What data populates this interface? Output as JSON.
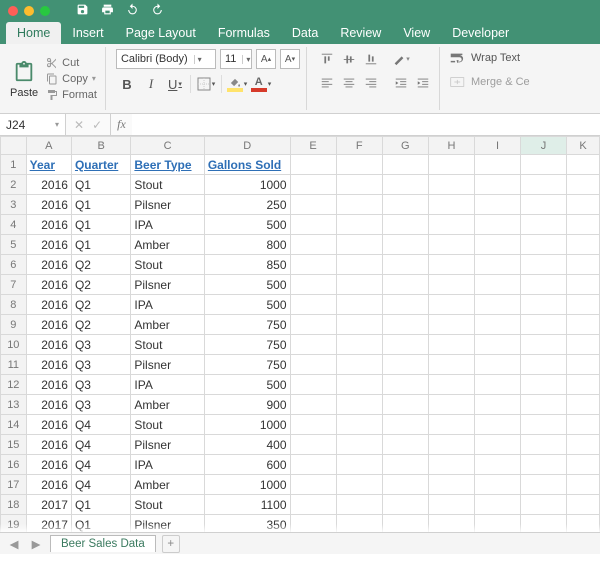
{
  "tabs": [
    "Home",
    "Insert",
    "Page Layout",
    "Formulas",
    "Data",
    "Review",
    "View",
    "Developer"
  ],
  "active_tab": 0,
  "clipboard": {
    "paste": "Paste",
    "cut": "Cut",
    "copy": "Copy",
    "format": "Format"
  },
  "font": {
    "name": "Calibri (Body)",
    "size": "11",
    "increase": "A▲",
    "decrease": "A▼",
    "bold": "B",
    "italic": "I",
    "underline": "U",
    "fill_color": "#ffe36b",
    "text_color": "#d63a2a"
  },
  "wrap": {
    "label": "Wrap Text",
    "merge": "Merge & Ce"
  },
  "namebox": "J24",
  "formula": "",
  "columns": [
    "A",
    "B",
    "C",
    "D",
    "E",
    "F",
    "G",
    "H",
    "I",
    "J",
    "K"
  ],
  "selected_col": "J",
  "headers": {
    "year": "Year",
    "quarter": "Quarter",
    "beer": "Beer Type",
    "gallons": "Gallons Sold"
  },
  "rows": [
    {
      "year": 2016,
      "quarter": "Q1",
      "beer": "Stout",
      "gallons": 1000
    },
    {
      "year": 2016,
      "quarter": "Q1",
      "beer": "Pilsner",
      "gallons": 250
    },
    {
      "year": 2016,
      "quarter": "Q1",
      "beer": "IPA",
      "gallons": 500
    },
    {
      "year": 2016,
      "quarter": "Q1",
      "beer": "Amber",
      "gallons": 800
    },
    {
      "year": 2016,
      "quarter": "Q2",
      "beer": "Stout",
      "gallons": 850
    },
    {
      "year": 2016,
      "quarter": "Q2",
      "beer": "Pilsner",
      "gallons": 500
    },
    {
      "year": 2016,
      "quarter": "Q2",
      "beer": "IPA",
      "gallons": 500
    },
    {
      "year": 2016,
      "quarter": "Q2",
      "beer": "Amber",
      "gallons": 750
    },
    {
      "year": 2016,
      "quarter": "Q3",
      "beer": "Stout",
      "gallons": 750
    },
    {
      "year": 2016,
      "quarter": "Q3",
      "beer": "Pilsner",
      "gallons": 750
    },
    {
      "year": 2016,
      "quarter": "Q3",
      "beer": "IPA",
      "gallons": 500
    },
    {
      "year": 2016,
      "quarter": "Q3",
      "beer": "Amber",
      "gallons": 900
    },
    {
      "year": 2016,
      "quarter": "Q4",
      "beer": "Stout",
      "gallons": 1000
    },
    {
      "year": 2016,
      "quarter": "Q4",
      "beer": "Pilsner",
      "gallons": 400
    },
    {
      "year": 2016,
      "quarter": "Q4",
      "beer": "IPA",
      "gallons": 600
    },
    {
      "year": 2016,
      "quarter": "Q4",
      "beer": "Amber",
      "gallons": 1000
    },
    {
      "year": 2017,
      "quarter": "Q1",
      "beer": "Stout",
      "gallons": 1100
    },
    {
      "year": 2017,
      "quarter": "Q1",
      "beer": "Pilsner",
      "gallons": 350
    }
  ],
  "sheets": {
    "active": "Beer Sales Data"
  }
}
